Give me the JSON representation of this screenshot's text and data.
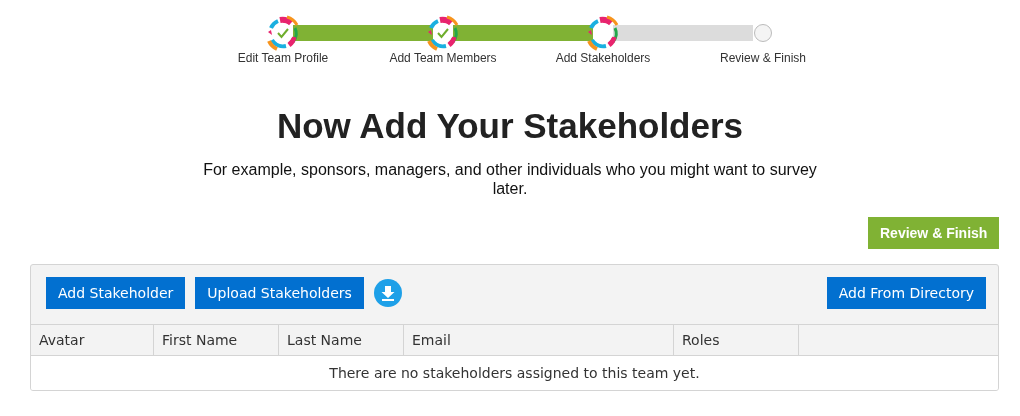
{
  "steps": [
    {
      "label": "Edit Team Profile",
      "kind": "done"
    },
    {
      "label": "Add Team Members",
      "kind": "done"
    },
    {
      "label": "Add Stakeholders",
      "kind": "current"
    },
    {
      "label": "Review & Finish",
      "kind": "pending"
    }
  ],
  "heading": "Now Add Your Stakeholders",
  "subtitle": "For example, sponsors, managers, and other individuals who you might want to survey later.",
  "primary_action": "Review & Finish",
  "toolbar": {
    "left_buttons": [
      "Add Stakeholder",
      "Upload Stakeholders"
    ],
    "right_button": "Add From Directory"
  },
  "table": {
    "columns": [
      "Avatar",
      "First Name",
      "Last Name",
      "Email",
      "Roles"
    ],
    "empty_message": "There are no stakeholders assigned to this team yet."
  }
}
